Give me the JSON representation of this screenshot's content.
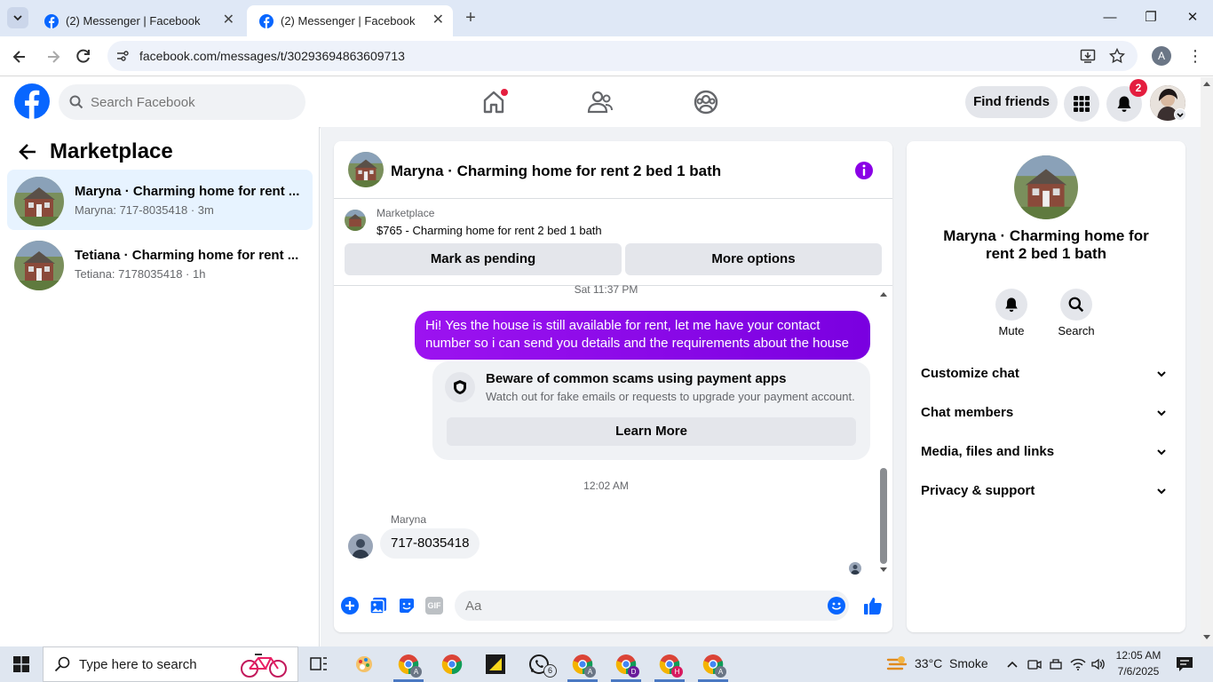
{
  "browser": {
    "tabs": [
      {
        "title": "(2) Messenger | Facebook",
        "active": false
      },
      {
        "title": "(2) Messenger | Facebook",
        "active": true
      }
    ],
    "url": "facebook.com/messages/t/30293694863609713",
    "profile_initial": "A"
  },
  "fb": {
    "search_placeholder": "Search Facebook",
    "find_friends": "Find friends",
    "notification_count": "2",
    "brand_color": "#0866ff"
  },
  "left": {
    "title": "Marketplace",
    "conversations": [
      {
        "title": "Maryna · Charming home for rent ...",
        "subtitle": "Maryna: 717-8035418 · 3m",
        "selected": true
      },
      {
        "title": "Tetiana · Charming home for rent ...",
        "subtitle": "Tetiana: 7178035418 · 1h",
        "selected": false
      }
    ]
  },
  "chat": {
    "title": "Maryna · Charming home for rent 2 bed 1 bath",
    "marketplace_label": "Marketplace",
    "listing": "$765 - Charming home for rent 2 bed 1 bath",
    "mark_pending": "Mark as pending",
    "more_options": "More options",
    "timestamp1": "Sat 11:37 PM",
    "outgoing_message": "Hi! Yes the house is still available for rent, let me have your contact number so i can send you details and the requirements about the house",
    "scam_title": "Beware of common scams using payment apps",
    "scam_body": "Watch out for fake emails or requests to upgrade your payment account.",
    "learn_more": "Learn More",
    "timestamp2": "12:02 AM",
    "sender_name": "Maryna",
    "incoming_message": "717-8035418",
    "composer_placeholder": "Aa",
    "accent_color": "#8a00e6"
  },
  "right": {
    "title": "Maryna · Charming home for rent 2 bed 1 bath",
    "mute": "Mute",
    "search": "Search",
    "sections": [
      "Customize chat",
      "Chat members",
      "Media, files and links",
      "Privacy & support"
    ]
  },
  "taskbar": {
    "search_placeholder": "Type here to search",
    "weather": "33°C  Smoke",
    "time": "12:05 AM",
    "date": "7/6/2025",
    "whatsapp_badge": "6",
    "chrome_badges": [
      "A",
      "D",
      "H",
      "A"
    ]
  }
}
